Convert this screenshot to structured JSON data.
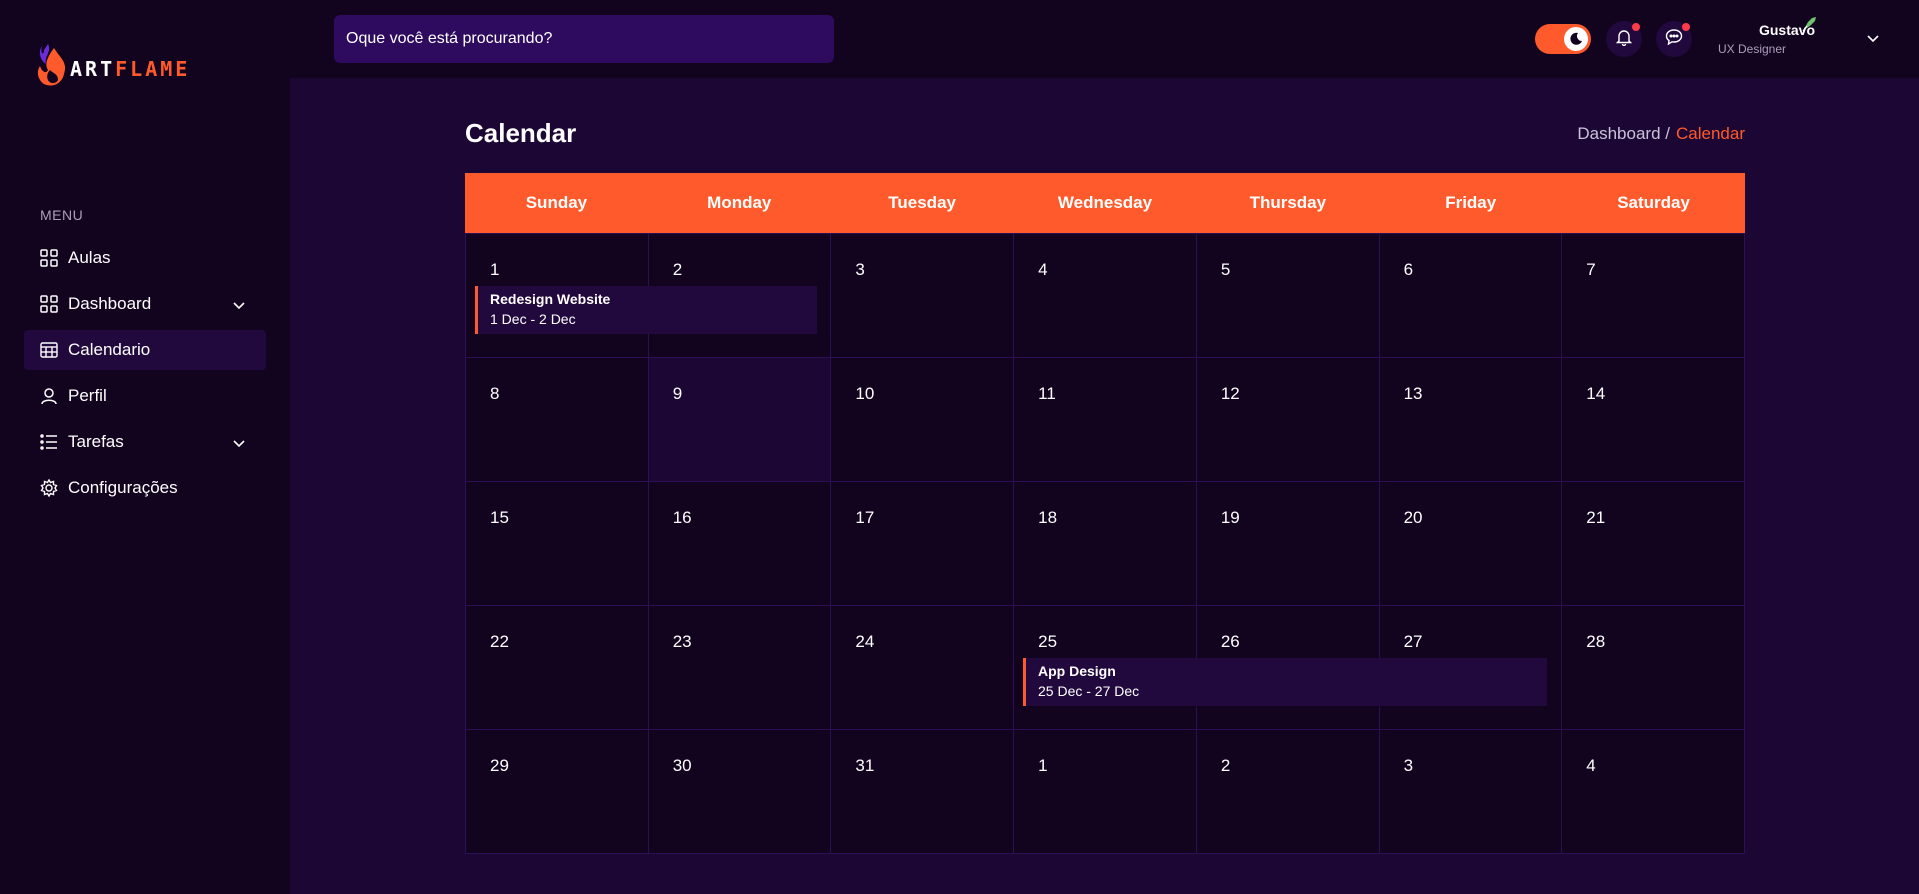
{
  "brand": {
    "part1": "ART",
    "part2": "FLAME",
    "accent": "#ff5a2b"
  },
  "search": {
    "placeholder": "Oque você está procurando?"
  },
  "header": {
    "user_name": "Gustavo",
    "user_role": "UX Designer",
    "theme_toggle": "dark-mode",
    "notifications_badge": true,
    "messages_badge": true
  },
  "sidebar": {
    "heading": "MENU",
    "items": [
      {
        "label": "Aulas",
        "icon": "grid-icon",
        "active": false,
        "expandable": false
      },
      {
        "label": "Dashboard",
        "icon": "grid-icon",
        "active": false,
        "expandable": true
      },
      {
        "label": "Calendario",
        "icon": "calendar-icon",
        "active": true,
        "expandable": false
      },
      {
        "label": "Perfil",
        "icon": "user-icon",
        "active": false,
        "expandable": false
      },
      {
        "label": "Tarefas",
        "icon": "list-icon",
        "active": false,
        "expandable": true
      },
      {
        "label": "Configurações",
        "icon": "gear-icon",
        "active": false,
        "expandable": false
      }
    ]
  },
  "page": {
    "title": "Calendar",
    "breadcrumb_home": "Dashboard /",
    "breadcrumb_current": "Calendar"
  },
  "calendar": {
    "weekdays": [
      "Sunday",
      "Monday",
      "Tuesday",
      "Wednesday",
      "Thursday",
      "Friday",
      "Saturday"
    ],
    "weeks": [
      [
        "1",
        "2",
        "3",
        "4",
        "5",
        "6",
        "7"
      ],
      [
        "8",
        "9",
        "10",
        "11",
        "12",
        "13",
        "14"
      ],
      [
        "15",
        "16",
        "17",
        "18",
        "19",
        "20",
        "21"
      ],
      [
        "22",
        "23",
        "24",
        "25",
        "26",
        "27",
        "28"
      ],
      [
        "29",
        "30",
        "31",
        "1",
        "2",
        "3",
        "4"
      ]
    ],
    "events": [
      {
        "title": "Redesign Website",
        "range": "1 Dec - 2 Dec"
      },
      {
        "title": "App Design",
        "range": "25 Dec - 27 Dec"
      }
    ]
  }
}
